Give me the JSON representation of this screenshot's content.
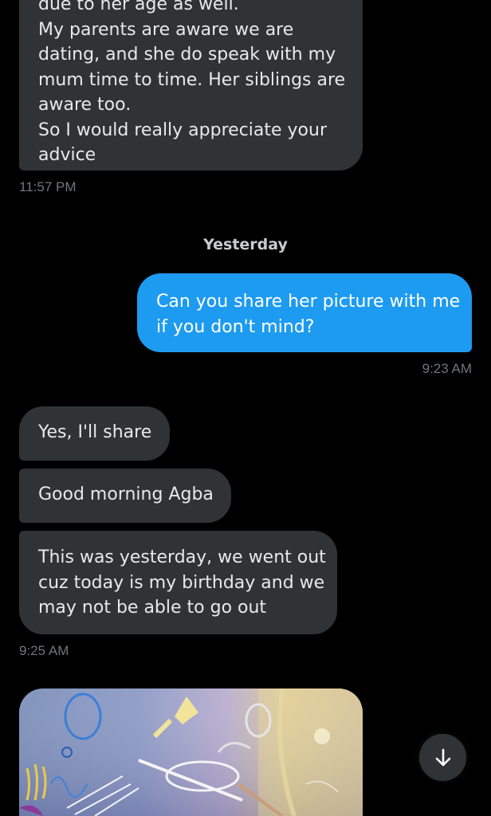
{
  "colors": {
    "background": "#000000",
    "incoming_bubble": "#2f3336",
    "outgoing_bubble": "#1d9bf0",
    "timestamp": "#71767b"
  },
  "messages": [
    {
      "direction": "incoming",
      "lines": [
        "due to her age as well.",
        "My parents are aware we are",
        "dating, and she do speak with my",
        "mum time to time. Her siblings are",
        "aware too.",
        "So I would really appreciate your",
        "advice"
      ],
      "time": "11:57 PM"
    },
    {
      "direction": "outgoing",
      "lines": [
        "Can you share her picture with me",
        "if you don't mind?"
      ],
      "time": "9:23 AM"
    },
    {
      "direction": "incoming",
      "lines": [
        "Yes, I'll share"
      ]
    },
    {
      "direction": "incoming",
      "lines": [
        "Good morning Agba"
      ]
    },
    {
      "direction": "incoming",
      "lines": [
        "This was yesterday, we went out",
        "cuz today is my birthday and we",
        "may not be able to go out"
      ],
      "time": "9:25 AM"
    }
  ],
  "date_separator": "Yesterday",
  "media": {
    "type": "photo",
    "icon": "image-attachment"
  },
  "scroll_button": {
    "icon": "arrow-down-icon"
  }
}
